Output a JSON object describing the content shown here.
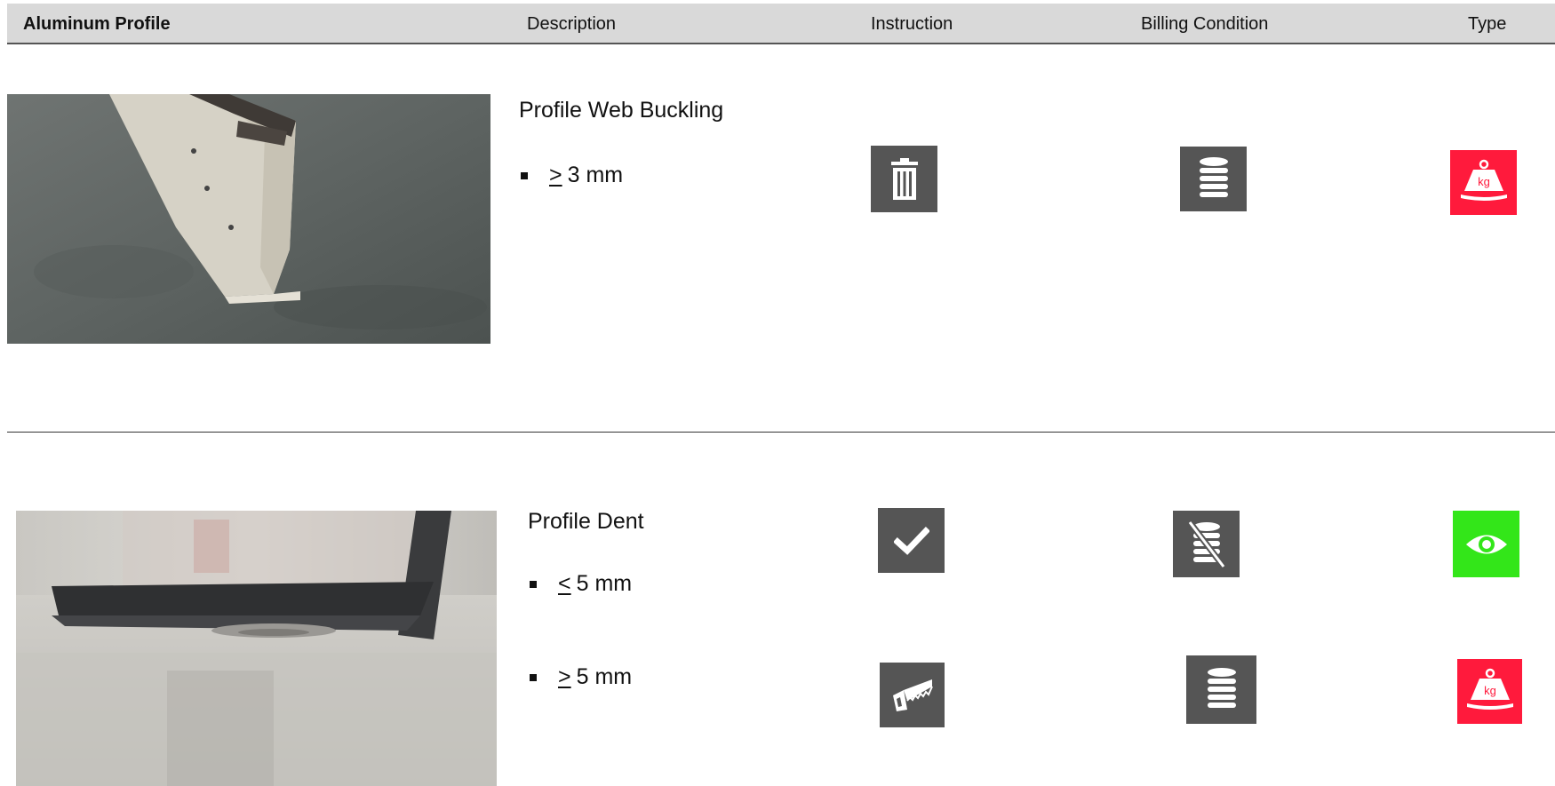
{
  "header": {
    "col1": "Aluminum Profile",
    "col2": "Description",
    "col3": "Instruction",
    "col4": "Billing Condition",
    "col5": "Type"
  },
  "rows": [
    {
      "title": "Profile Web Buckling",
      "conditions": [
        {
          "operator": ">",
          "value": "3 mm",
          "instruction_icon": "trash-icon",
          "billing_icon": "coin-stack-icon",
          "type_icon": "weight-kg-icon"
        }
      ]
    },
    {
      "title": "Profile Dent",
      "conditions": [
        {
          "operator": "<",
          "value": "5 mm",
          "instruction_icon": "checkmark-icon",
          "billing_icon": "no-billing-icon",
          "type_icon": "eye-icon"
        },
        {
          "operator": ">",
          "value": "5 mm",
          "instruction_icon": "saw-icon",
          "billing_icon": "coin-stack-icon",
          "type_icon": "weight-kg-icon"
        }
      ]
    }
  ],
  "icon_text": {
    "kg": "kg"
  },
  "colors": {
    "icon_gray": "#555555",
    "type_red": "#ff1a3c",
    "type_green": "#33e619",
    "header_bg": "#d9d9d9"
  }
}
